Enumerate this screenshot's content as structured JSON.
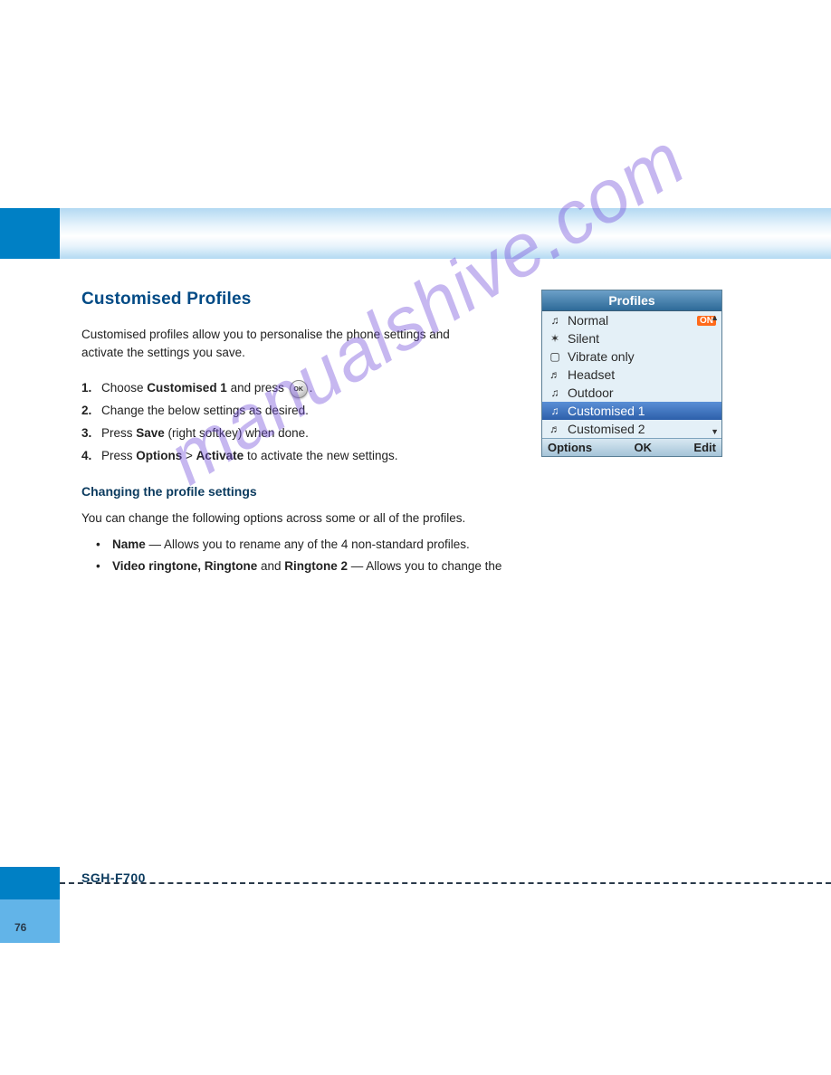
{
  "watermark": "manualshive.com",
  "section": {
    "title": "Customised Profiles",
    "intro": "Customised profiles allow you to personalise the phone settings and activate the settings you save."
  },
  "steps": [
    {
      "n": "1.",
      "text_before": "Choose ",
      "action": "Customised 1",
      "text_mid": " and press ",
      "icon": "OK",
      "text_after": "."
    },
    {
      "n": "2.",
      "text": "Change the below settings as desired."
    },
    {
      "n": "3.",
      "text_before": "Press ",
      "action": "Save",
      "text_mid": " (right softkey) when done.",
      "text_after": ""
    },
    {
      "n": "4.",
      "text_before": "Press ",
      "action": "Options",
      "text_mid": " > ",
      "action2": "Activate",
      "text_after": " to activate the new settings."
    }
  ],
  "sub": {
    "title": "Changing the profile settings",
    "intro": "You can change the following options across some or all of the profiles."
  },
  "bullets": [
    {
      "label": "Name",
      "desc": " — Allows you to rename any of the 4 non-standard profiles."
    },
    {
      "label": "Video ringtone, ",
      "label2": "Ringtone",
      "desc_mid": " and ",
      "label3": "Ringtone 2",
      "desc": " — Allows you to change the"
    }
  ],
  "phone": {
    "title": "Profiles",
    "items": [
      {
        "icon": "♫",
        "label": "Normal",
        "badge": "ON",
        "selected": false
      },
      {
        "icon": "✶",
        "label": "Silent",
        "selected": false
      },
      {
        "icon": "▢",
        "label": "Vibrate only",
        "selected": false
      },
      {
        "icon": "♬",
        "label": "Headset",
        "selected": false
      },
      {
        "icon": "♫",
        "label": "Outdoor",
        "selected": false
      },
      {
        "icon": "♫",
        "label": "Customised 1",
        "selected": true
      },
      {
        "icon": "♬",
        "label": "Customised 2",
        "selected": false
      }
    ],
    "softkeys": {
      "left": "Options",
      "center": "OK",
      "right": "Edit"
    }
  },
  "footer": {
    "logo": "SGH-F700",
    "page": "76"
  }
}
